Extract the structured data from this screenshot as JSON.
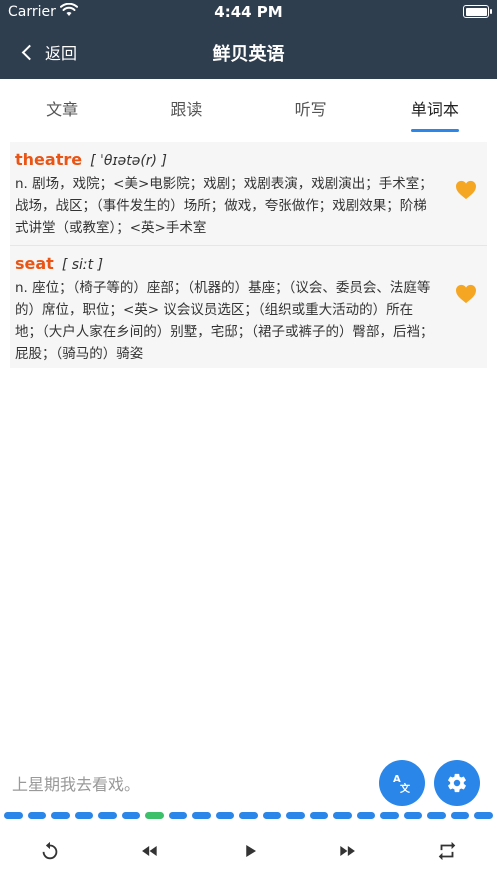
{
  "status_bar": {
    "carrier": "Carrier",
    "time": "4:44 PM"
  },
  "nav": {
    "back_label": "返回",
    "title": "鲜贝英语"
  },
  "tabs": [
    {
      "label": "文章",
      "active": false
    },
    {
      "label": "跟读",
      "active": false
    },
    {
      "label": "听写",
      "active": false
    },
    {
      "label": "单词本",
      "active": true
    }
  ],
  "words": [
    {
      "word": "theatre",
      "phonetic": "[ ˈθɪətə(r) ]",
      "definition": "n. 剧场，戏院；<美>电影院；戏剧；戏剧表演，戏剧演出；手术室；战场，战区；（事件发生的）场所；做戏，夸张做作；戏剧效果；阶梯式讲堂（或教室）；<英>手术室",
      "favorited": true
    },
    {
      "word": "seat",
      "phonetic": "[ siːt ]",
      "definition": "n. 座位；（椅子等的）座部；（机器的）基座；（议会、委员会、法庭等的）席位，职位；<英> 议会议员选区；（组织或重大活动的）所在地；（大户人家在乡间的）别墅，宅邸；（裙子或裤子的）臀部，后裆；屁股；（骑马的）骑姿",
      "favorited": true
    }
  ],
  "sentence": "上星期我去看戏。",
  "progress": {
    "total_segments": 21,
    "current_segment": 6
  },
  "colors": {
    "header": "#2f3e4e",
    "accent": "#2a86e8",
    "word": "#ea5414",
    "heart": "#f5a623",
    "current_segment": "#3cc06a"
  },
  "icons": {
    "translate": "translate-icon",
    "settings": "gear-icon",
    "replay": "replay-icon",
    "previous": "rewind-icon",
    "play": "play-icon",
    "next": "fast-forward-icon",
    "repeat": "repeat-icon"
  }
}
